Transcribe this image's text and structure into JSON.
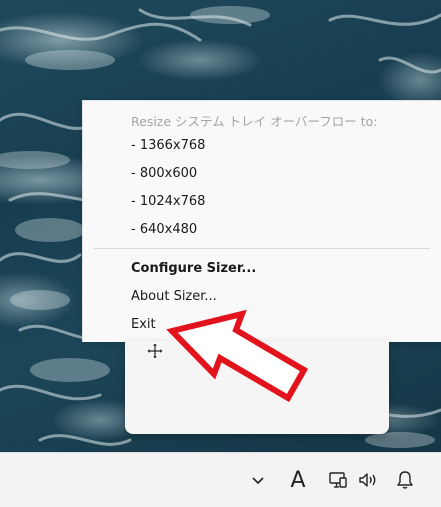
{
  "menu": {
    "header": "Resize システム トレイ オーバーフロー  to:",
    "sizes": [
      "- 1366x768",
      "- 800x600",
      "- 1024x768",
      "- 640x480"
    ],
    "configure": "Configure Sizer...",
    "about": "About Sizer...",
    "exit": "Exit"
  },
  "taskbar": {
    "ime_label": "A",
    "icons": [
      "chevron-up-icon",
      "ime-icon",
      "network-icon",
      "volume-icon",
      "bell-icon"
    ]
  },
  "colors": {
    "arrow": "#e3131e",
    "menu_bg": "#f9f9f9",
    "header_text": "#a4a4a4"
  }
}
